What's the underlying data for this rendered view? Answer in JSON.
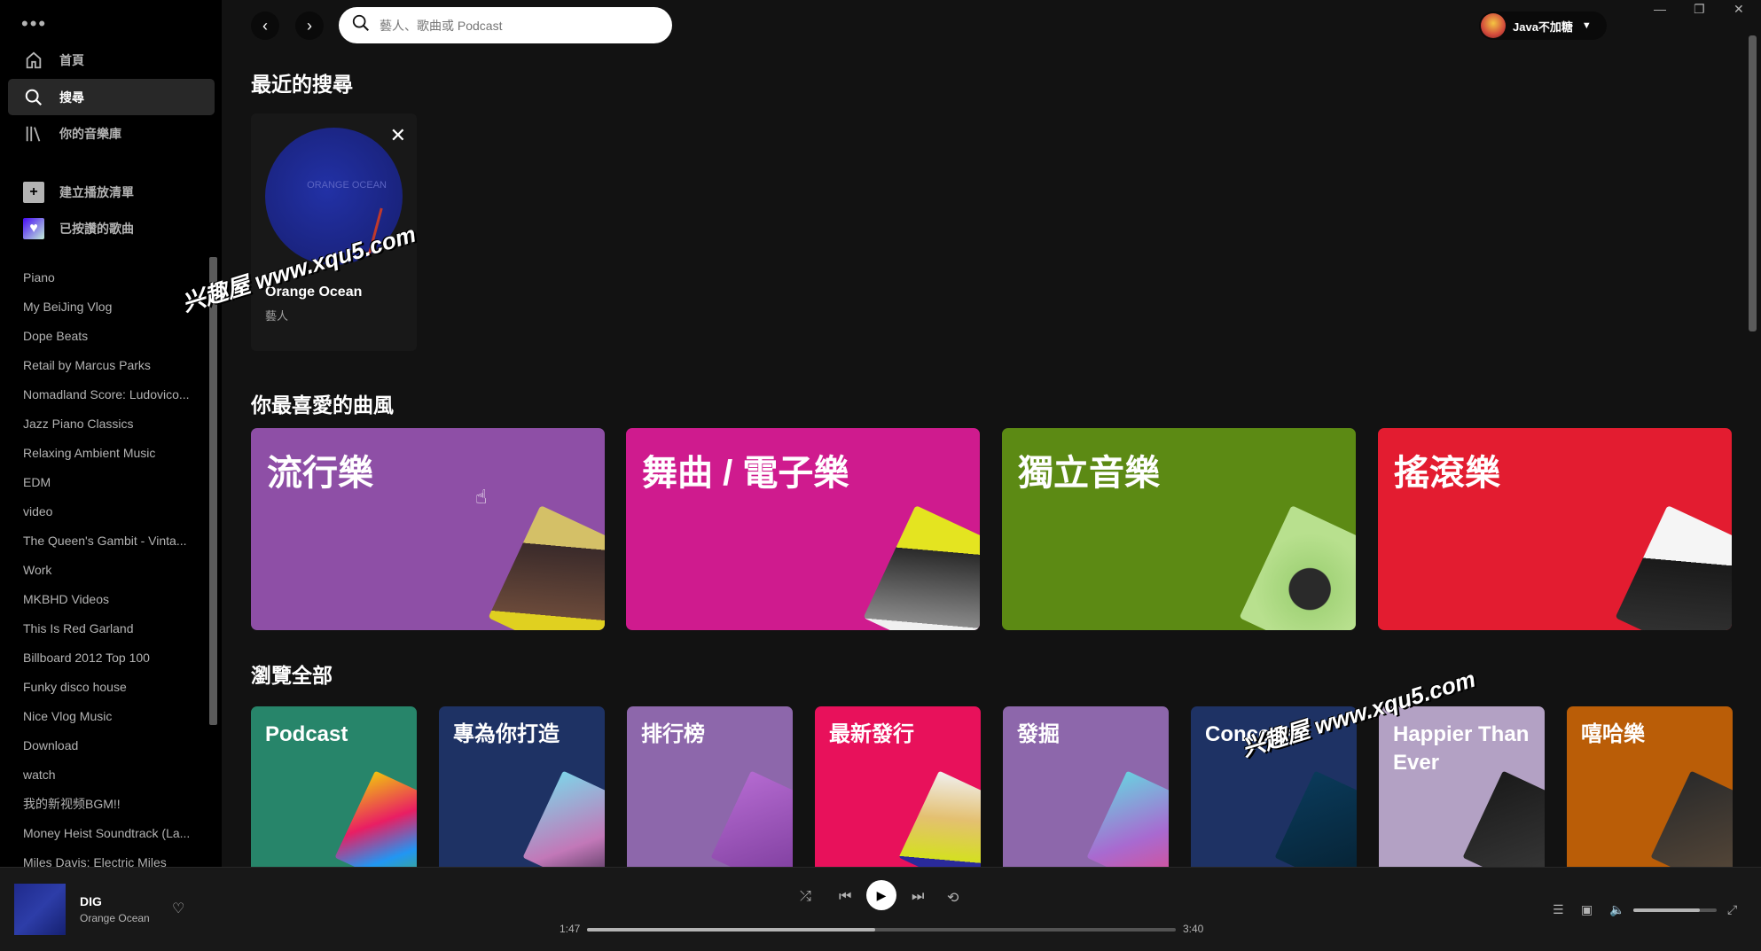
{
  "topbar": {
    "search_placeholder": "藝人、歌曲或 Podcast",
    "user_name": "Java不加糖"
  },
  "sidebar": {
    "nav": [
      {
        "label": "首頁",
        "icon": "home-icon"
      },
      {
        "label": "搜尋",
        "icon": "search-icon",
        "active": true
      },
      {
        "label": "你的音樂庫",
        "icon": "library-icon"
      }
    ],
    "create_playlist": "建立播放清單",
    "liked_songs": "已按讚的歌曲",
    "playlists": [
      "Piano",
      "My BeiJing Vlog",
      "Dope Beats",
      "Retail by Marcus Parks",
      "Nomadland Score: Ludovico...",
      "Jazz Piano Classics",
      "Relaxing Ambient Music",
      "EDM",
      "video",
      "The Queen's Gambit - Vinta...",
      "Work",
      "MKBHD Videos",
      "This Is Red Garland",
      "Billboard 2012 Top 100",
      "Funky disco house",
      "Nice Vlog Music",
      "Download",
      "watch",
      "我的新视频BGM!!",
      "Money Heist Soundtrack (La...",
      "Miles Davis: Electric Miles"
    ]
  },
  "main": {
    "recent_heading": "最近的搜尋",
    "recent": {
      "title": "Orange Ocean",
      "subtitle": "藝人",
      "art_text": "ORANGE OCEAN"
    },
    "genres_heading": "你最喜愛的曲風",
    "genres": [
      {
        "label": "流行樂",
        "color": "#8e4fa6"
      },
      {
        "label": "舞曲 / 電子樂",
        "color": "#cf1b8e"
      },
      {
        "label": "獨立音樂",
        "color": "#5c8a14"
      },
      {
        "label": "搖滾樂",
        "color": "#e31c30"
      }
    ],
    "browse_heading": "瀏覽全部",
    "browse": [
      {
        "label": "Podcast",
        "color": "#27856a"
      },
      {
        "label": "專為你打造",
        "color": "#1e3264"
      },
      {
        "label": "排行榜",
        "color": "#8d67ab"
      },
      {
        "label": "最新發行",
        "color": "#e8115b"
      },
      {
        "label": "發掘",
        "color": "#8d67ab"
      },
      {
        "label": "Concerts",
        "color": "#1e3264"
      },
      {
        "label": "Happier Than Ever",
        "color": "#b3a1c4"
      },
      {
        "label": "嘻哈樂",
        "color": "#ba5d07"
      }
    ]
  },
  "watermark": "兴趣屋 www.xqu5.com",
  "player": {
    "title": "DIG",
    "artist": "Orange Ocean",
    "elapsed": "1:47",
    "duration": "3:40",
    "progress_fraction": 0.49,
    "volume_fraction": 0.8
  }
}
